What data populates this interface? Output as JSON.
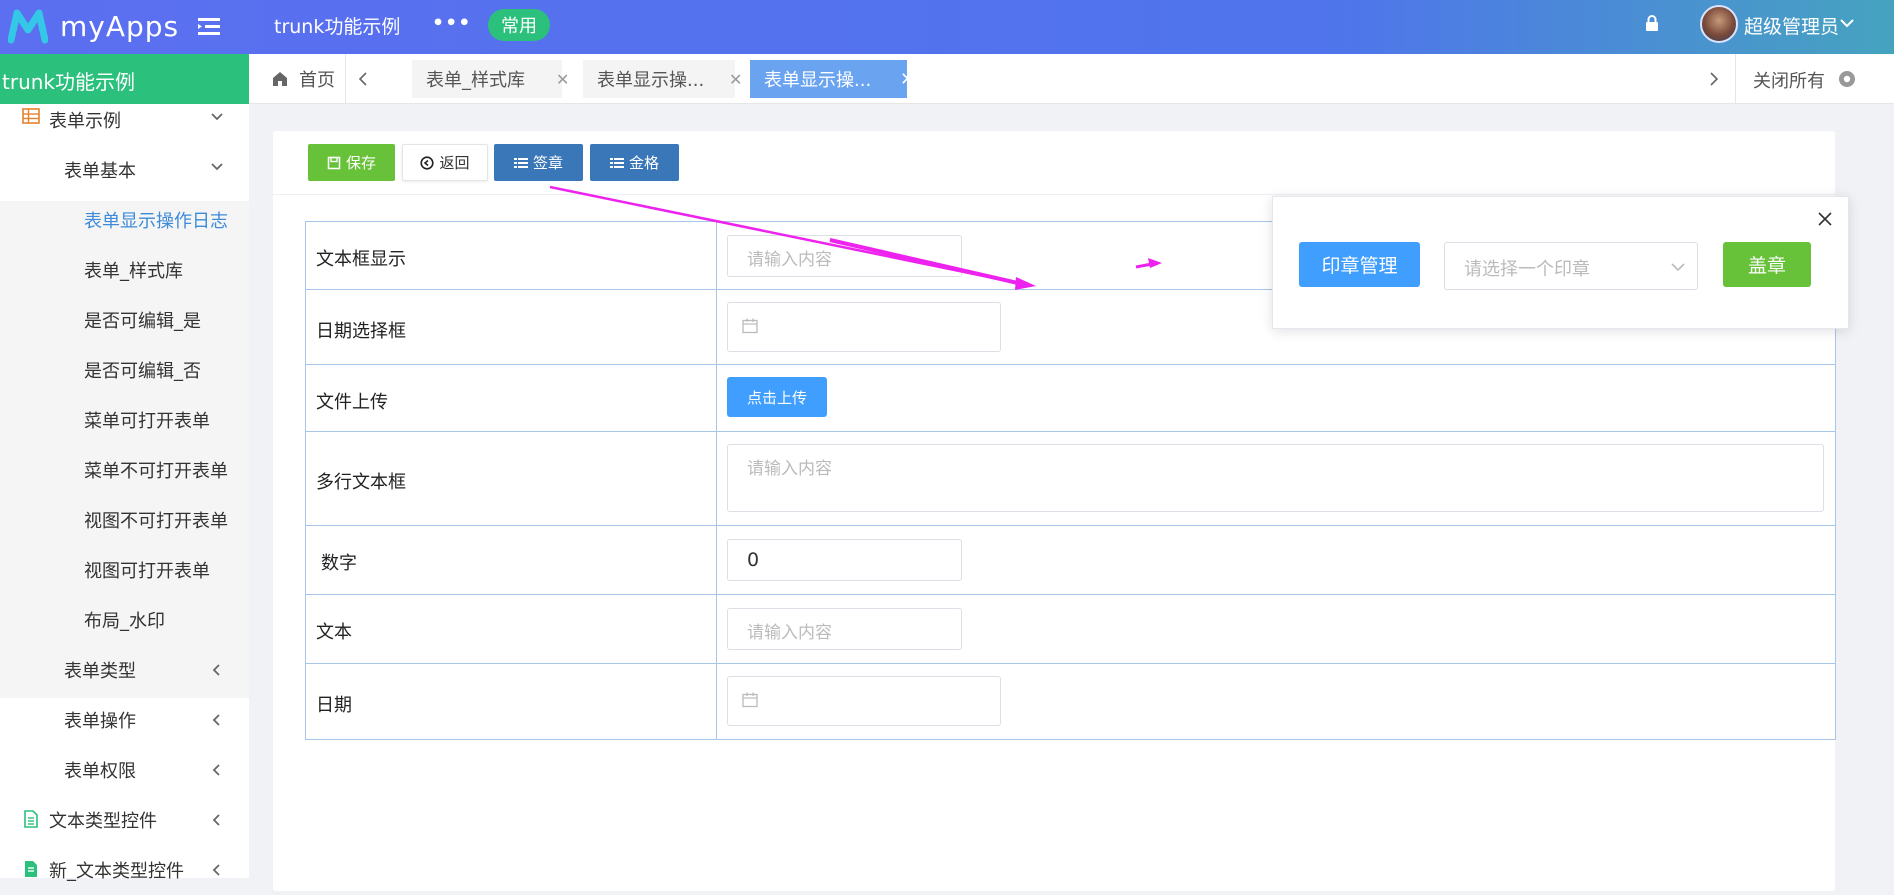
{
  "colors": {
    "topbar_start": "#5b6ff0",
    "topbar_end": "#46a3c0",
    "sidebar_header": "#2bc07c",
    "active_tab": "#6aa3f0",
    "primary": "#409eff",
    "success": "#67c23a",
    "dark_blue": "#3977b8",
    "annotation": "#ee22ee"
  },
  "topbar": {
    "logo_text": "myApps",
    "app_title": "trunk功能示例",
    "more": "•••",
    "badge": "常用",
    "username": "超级管理员"
  },
  "sidebar": {
    "header": "trunk功能示例",
    "items": [
      {
        "label": "表单示例",
        "icon": "table-icon"
      },
      {
        "label": "表单基本"
      },
      {
        "label": "表单显示操作日志"
      },
      {
        "label": "表单_样式库"
      },
      {
        "label": "是否可编辑_是"
      },
      {
        "label": "是否可编辑_否"
      },
      {
        "label": "菜单可打开表单"
      },
      {
        "label": "菜单不可打开表单"
      },
      {
        "label": "视图不可打开表单"
      },
      {
        "label": "视图可打开表单"
      },
      {
        "label": "布局_水印"
      },
      {
        "label": "表单类型"
      },
      {
        "label": "表单操作"
      },
      {
        "label": "表单权限"
      },
      {
        "label": "文本类型控件",
        "icon": "document-icon"
      },
      {
        "label": "新_文本类型控件",
        "icon": "document-icon"
      }
    ]
  },
  "tabs": {
    "home": "首页",
    "items": [
      {
        "label": "表单_样式库",
        "close": "✕"
      },
      {
        "label": "表单显示操...",
        "close": "✕"
      },
      {
        "label": "表单显示操...",
        "close": "✕"
      }
    ],
    "close_all": "关闭所有"
  },
  "toolbar": {
    "save": "保存",
    "back": "返回",
    "sign": "签章",
    "jin": "金格"
  },
  "form": {
    "rows": [
      {
        "label": "文本框显示",
        "placeholder": "请输入内容"
      },
      {
        "label": "日期选择框"
      },
      {
        "label": "文件上传",
        "button": "点击上传"
      },
      {
        "label": "多行文本框",
        "placeholder": "请输入内容"
      },
      {
        "label": "数字",
        "value": "0"
      },
      {
        "label": "文本",
        "placeholder": "请输入内容"
      },
      {
        "label": "日期"
      }
    ]
  },
  "stamp_popover": {
    "manage": "印章管理",
    "select_placeholder": "请选择一个印章",
    "stamp": "盖章"
  }
}
